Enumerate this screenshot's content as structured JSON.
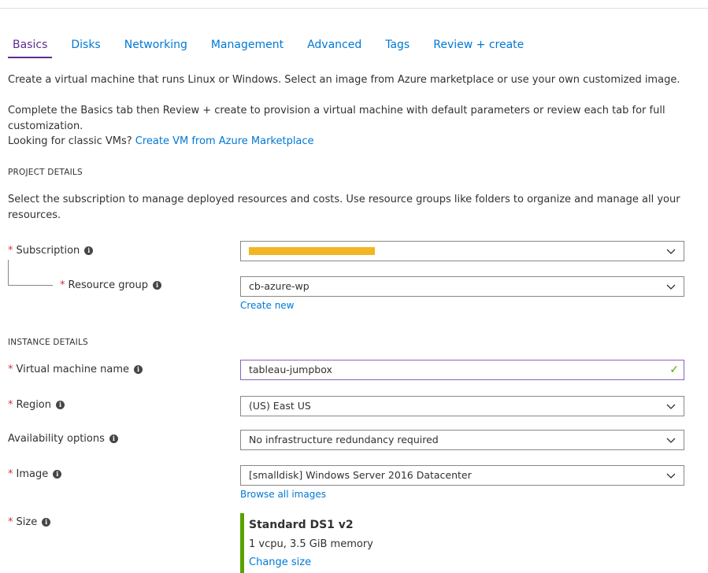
{
  "tabs": [
    {
      "label": "Basics"
    },
    {
      "label": "Disks"
    },
    {
      "label": "Networking"
    },
    {
      "label": "Management"
    },
    {
      "label": "Advanced"
    },
    {
      "label": "Tags"
    },
    {
      "label": "Review + create"
    }
  ],
  "intro": {
    "line1": "Create a virtual machine that runs Linux or Windows. Select an image from Azure marketplace or use your own customized image.",
    "line2": "Complete the Basics tab then Review + create to provision a virtual machine with default parameters or review each tab for full customization.",
    "classic_prefix": "Looking for classic VMs?",
    "classic_link": "Create VM from Azure Marketplace"
  },
  "project": {
    "header": "PROJECT DETAILS",
    "description": "Select the subscription to manage deployed resources and costs. Use resource groups like folders to organize and manage all your resources.",
    "subscription_label": "Subscription",
    "resource_group_label": "Resource group",
    "resource_group_value": "cb-azure-wp",
    "create_new": "Create new"
  },
  "instance": {
    "header": "INSTANCE DETAILS",
    "vm_name_label": "Virtual machine name",
    "vm_name_value": "tableau-jumpbox",
    "region_label": "Region",
    "region_value": "(US) East US",
    "availability_label": "Availability options",
    "availability_value": "No infrastructure redundancy required",
    "image_label": "Image",
    "image_value": "[smalldisk] Windows Server 2016 Datacenter",
    "browse_images": "Browse all images",
    "size_label": "Size",
    "size_name": "Standard DS1 v2",
    "size_desc": "1 vcpu, 3.5 GiB memory",
    "change_size": "Change size"
  },
  "glyphs": {
    "required": "*",
    "info": "i",
    "check": "✓"
  },
  "colors": {
    "accent": "#5c2d91",
    "link": "#0078d4",
    "required": "#d13438",
    "success": "#57a300",
    "redaction": "#f2b524"
  }
}
